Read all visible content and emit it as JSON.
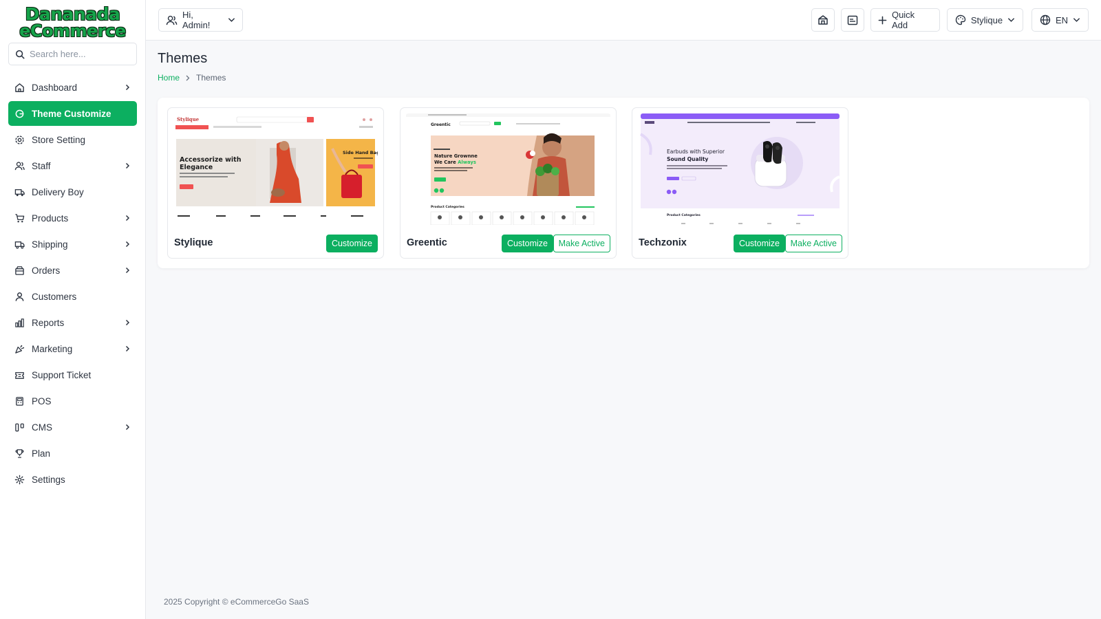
{
  "brand": {
    "line1": "Dananada",
    "line2": "eCommerce",
    "color": "#16a34a"
  },
  "search": {
    "placeholder": "Search here..."
  },
  "menu": [
    {
      "label": "Dashboard",
      "icon": "home-icon",
      "chevron": true
    },
    {
      "label": "Theme Customize",
      "icon": "theme-icon",
      "chevron": false,
      "active": true
    },
    {
      "label": "Store Setting",
      "icon": "settings-icon",
      "chevron": false
    },
    {
      "label": "Staff",
      "icon": "users-icon",
      "chevron": true
    },
    {
      "label": "Delivery Boy",
      "icon": "truck-icon",
      "chevron": false
    },
    {
      "label": "Products",
      "icon": "cart-icon",
      "chevron": true
    },
    {
      "label": "Shipping",
      "icon": "shipping-icon",
      "chevron": true
    },
    {
      "label": "Orders",
      "icon": "box-icon",
      "chevron": true
    },
    {
      "label": "Customers",
      "icon": "user-icon",
      "chevron": false
    },
    {
      "label": "Reports",
      "icon": "chart-icon",
      "chevron": true
    },
    {
      "label": "Marketing",
      "icon": "confetti-icon",
      "chevron": true
    },
    {
      "label": "Support Ticket",
      "icon": "ticket-icon",
      "chevron": false
    },
    {
      "label": "POS",
      "icon": "pos-icon",
      "chevron": false
    },
    {
      "label": "CMS",
      "icon": "columns-icon",
      "chevron": true
    },
    {
      "label": "Plan",
      "icon": "trophy-icon",
      "chevron": false
    },
    {
      "label": "Settings",
      "icon": "gear-icon",
      "chevron": false
    }
  ],
  "header": {
    "greeting": "Hi, Admin!",
    "quick_add": "Quick Add",
    "theme_select": "Stylique",
    "language": "EN"
  },
  "page": {
    "title": "Themes",
    "breadcrumb": [
      "Home",
      "Themes"
    ]
  },
  "themes": [
    {
      "name": "Stylique",
      "customize": "Customize",
      "preview": {
        "logo": "Stylique",
        "headline1": "Accessorize with",
        "headline2": "Elegance",
        "side_title": "Side Hand Bag",
        "accent": "#f05252"
      }
    },
    {
      "name": "Greentic",
      "customize": "Customize",
      "make_active": "Make Active",
      "preview": {
        "logo": "Greentic",
        "headline1": "Nature Grownne",
        "headline2a": "We Care ",
        "headline2b": "Always",
        "section": "Product Categories",
        "accent": "#22c55e"
      }
    },
    {
      "name": "Techzonix",
      "customize": "Customize",
      "make_active": "Make Active",
      "preview": {
        "headline1": "Earbuds with Superior",
        "headline2": "Sound Quality",
        "section": "Product Categories",
        "accent": "#9b5de5"
      }
    }
  ],
  "footer": {
    "text": "2025 Copyright © eCommerceGo SaaS"
  },
  "colors": {
    "primary": "#0caf60"
  }
}
